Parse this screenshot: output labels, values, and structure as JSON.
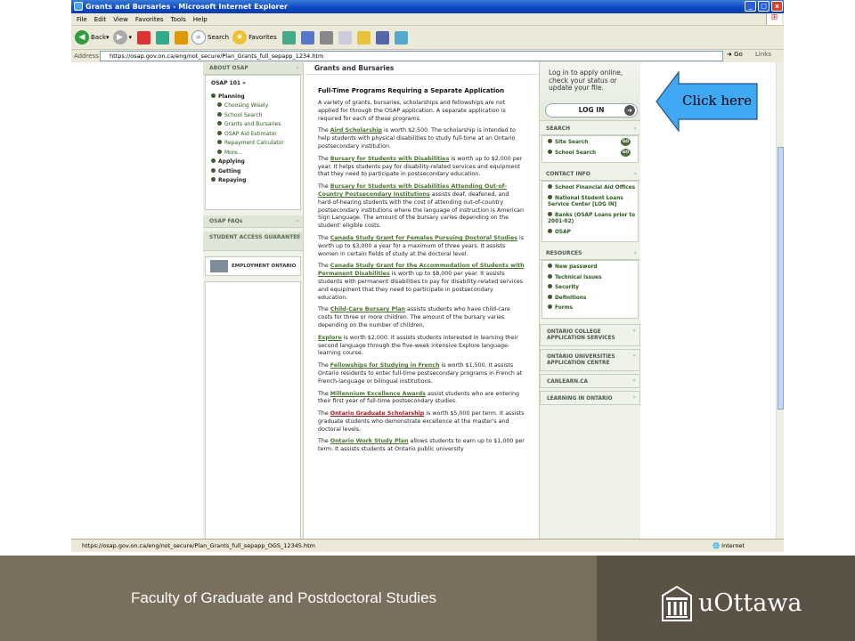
{
  "window": {
    "title": "Grants and Bursaries - Microsoft Internet Explorer"
  },
  "menu": [
    "File",
    "Edit",
    "View",
    "Favorites",
    "Tools",
    "Help"
  ],
  "toolbar": {
    "back": "Back",
    "search": "Search",
    "favorites": "Favorites"
  },
  "address": {
    "label": "Address",
    "url": "https://osap.gov.on.ca/eng/not_secure/Plan_Grants_full_sepapp_1234.htm",
    "go": "Go",
    "links": "Links"
  },
  "status": {
    "url": "https://osap.gov.on.ca/eng/not_secure/Plan_Grants_full_sepapp_OGS_12345.htm",
    "zone": "Internet"
  },
  "left_nav": {
    "about": "ABOUT OSAP",
    "osap101": "OSAP 101",
    "planning": "Planning",
    "planning_items": [
      "Choosing Wisely",
      "School Search",
      "Grants and Bursaries",
      "OSAP Aid Estimator",
      "Repayment Calculator",
      "More..."
    ],
    "applying": "Applying",
    "getting": "Getting",
    "repaying": "Repaying",
    "faqs": "OSAP FAQs",
    "student_access": "STUDENT ACCESS GUARANTEE",
    "employment": "EMPLOYMENT ONTARIO"
  },
  "main": {
    "title": "Grants and Bursaries",
    "heading": "Full-Time Programs Requiring a Separate Application",
    "intro": "A variety of grants, bursaries, scholarships and fellowships are not applied for through the OSAP application. A separate application is required for each of these programs.",
    "programs": [
      {
        "pre": "The ",
        "link": "Aird Scholarship",
        "post": " is worth $2,500. The scholarship is intended to help students with physical disabilities to study full-time at an Ontario postsecondary institution."
      },
      {
        "pre": "The ",
        "link": "Bursary for Students with Disabilities",
        "post": " is worth up to $2,000 per year. It helps students pay for disability-related services and equipment that they need to participate in postsecondary education."
      },
      {
        "pre": "The ",
        "link": "Bursary for Students with Disabilities Attending Out-of-Country Postsecondary Institutions",
        "post": " assists deaf, deafened, and hard-of-hearing students with the cost of attending out-of-country postsecondary institutions where the language of instruction is American Sign Language. The amount of the bursary varies depending on the student' eligible costs."
      },
      {
        "pre": "The ",
        "link": "Canada Study Grant for Females Pursuing Doctoral Studies",
        "post": " is worth up to $3,000 a year for a maximum of three years. It assists women in certain fields of study at the doctoral level."
      },
      {
        "pre": "The ",
        "link": "Canada Study Grant for the Accommodation of Students with Permanent Disabilities",
        "post": " is worth up to $8,000 per year. It assists students with permanent disabilities to pay for disability-related services and equipment that they need to participate in postsecondary education."
      },
      {
        "pre": "The ",
        "link": "Child-Care Bursary Plan",
        "post": " assists students who have child-care costs for three or more children. The amount of the bursary varies depending on the number of children."
      },
      {
        "pre": "",
        "link": "Explore",
        "post": " is worth $2,000. It assists students interested in learning their second language through the five-week intensive Explore language-learning course."
      },
      {
        "pre": "The ",
        "link": "Fellowships for Studying in French",
        "post": " is worth $1,500. It assists Ontario residents to enter full-time postsecondary programs in French at French-language or bilingual institutions."
      },
      {
        "pre": "The ",
        "link": "Millennium Excellence Awards",
        "post": " assist students who are entering their first year of full-time postsecondary studies."
      },
      {
        "pre": "The ",
        "link": "Ontario Graduate Scholarship",
        "post": " is worth $5,000 per term. It assists graduate students who demonstrate excellence at the master's and doctoral levels."
      },
      {
        "pre": "The ",
        "link": "Ontario Work Study Plan",
        "post": " allows students to earn up to $1,000 per term. It assists students at Ontario public university"
      }
    ]
  },
  "right_nav": {
    "login_text": "Log in to apply online, check your status or update your file.",
    "login_button": "LOG IN",
    "search": "SEARCH",
    "search_items": [
      "Site Search",
      "School Search"
    ],
    "go": "GO",
    "contact": "CONTACT INFO",
    "contact_items": [
      "School Financial Aid Offices",
      "National Student Loans Service Center [LOG IN]",
      "Banks (OSAP Loans prior to 2001-02)",
      "OSAP"
    ],
    "resources": "RESOURCES",
    "resource_items": [
      "New password",
      "Technical issues",
      "Security",
      "Definitions",
      "Forms"
    ],
    "links": [
      "ONTARIO COLLEGE APPLICATION SERVICES",
      "ONTARIO UNIVERSITIES APPLICATION CENTRE",
      "CANLEARN.CA",
      "LEARNING IN ONTARIO"
    ]
  },
  "callout": "Click here",
  "footer": {
    "faculty": "Faculty of Graduate and Postdoctoral Studies",
    "university": "uOttawa"
  },
  "colors": {
    "link": "#4b7330",
    "footer": "#7a6e5c",
    "footer_dark": "#5b5246",
    "callout": "#3fa9f5"
  }
}
